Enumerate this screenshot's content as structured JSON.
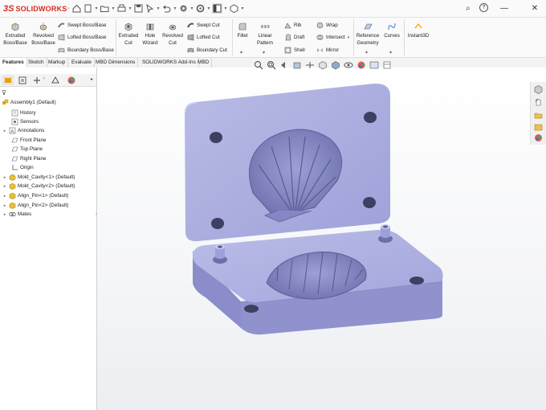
{
  "app": {
    "brand": "SOLIDWORKS",
    "brand_mark": "3S"
  },
  "window_controls": {
    "search": "⌕",
    "help": "?",
    "minimize": "—",
    "close": "✕"
  },
  "ribbon": {
    "extruded_boss": "Extruded\nBoss/Base",
    "revolved_boss": "Revolved\nBoss/Base",
    "swept_boss": "Swept Boss/Base",
    "lofted_boss": "Lofted Boss/Base",
    "boundary_boss": "Boundary Boss/Base",
    "extruded_cut": "Extruded\nCut",
    "hole_wizard": "Hole\nWizard",
    "revolved_cut": "Revolved\nCut",
    "swept_cut": "Swept Cut",
    "lofted_cut": "Lofted Cut",
    "boundary_cut": "Boundary Cut",
    "fillet": "Fillet",
    "linear_pattern": "Linear\nPattern",
    "rib": "Rib",
    "draft": "Draft",
    "shell": "Shell",
    "wrap": "Wrap",
    "intersect": "Intersect",
    "mirror": "Mirror",
    "reference_geometry": "Reference\nGeometry",
    "curves": "Curves",
    "instant3d": "Instant3D"
  },
  "tabs": [
    "Features",
    "Sketch",
    "Markup",
    "Evaluate",
    "MBD Dimensions",
    "SOLIDWORKS Add-Ins",
    "MBD"
  ],
  "active_tab": "Features",
  "tree": {
    "root": "Assembly1  (Default)",
    "items": [
      {
        "label": "History",
        "icon": "history-icon"
      },
      {
        "label": "Sensors",
        "icon": "sensor-icon"
      },
      {
        "label": "Annotations",
        "icon": "annotation-icon"
      },
      {
        "label": "Front Plane",
        "icon": "plane-icon"
      },
      {
        "label": "Top Plane",
        "icon": "plane-icon"
      },
      {
        "label": "Right Plane",
        "icon": "plane-icon"
      },
      {
        "label": "Origin",
        "icon": "origin-icon"
      },
      {
        "label": "Mold_Cavity<1> (Default)",
        "icon": "part-icon"
      },
      {
        "label": "Mold_Cavity<2> (Default)",
        "icon": "part-icon"
      },
      {
        "label": "Align_Pin<1> (Default)",
        "icon": "part-icon"
      },
      {
        "label": "Align_Pin<2> (Default)",
        "icon": "part-icon"
      },
      {
        "label": "Mates",
        "icon": "mates-icon"
      }
    ]
  },
  "colors": {
    "brand": "#d52b1e",
    "mold": "#a7a9dc",
    "accent": "#f0a000"
  }
}
